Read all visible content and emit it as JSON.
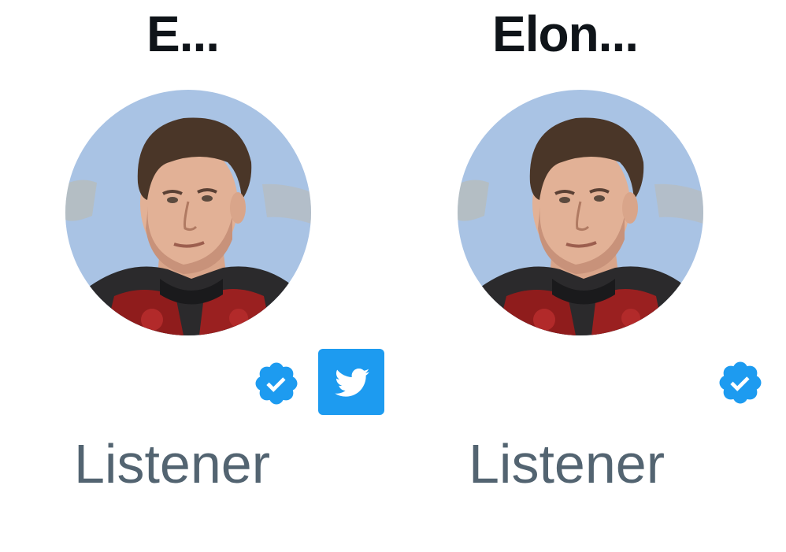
{
  "colors": {
    "accent": "#1d9bf0",
    "name_text": "#0f1419",
    "secondary_text": "#536471",
    "background": "#ffffff"
  },
  "speakers": [
    {
      "display_name": "E...",
      "role": "Listener",
      "avatar_icon": "profile-photo",
      "verified_icon": "verified-badge-icon",
      "extra_badge_icon": "twitter-bird-icon"
    },
    {
      "display_name": "Elon...",
      "role": "Listener",
      "avatar_icon": "profile-photo",
      "verified_icon": "verified-badge-icon"
    }
  ]
}
